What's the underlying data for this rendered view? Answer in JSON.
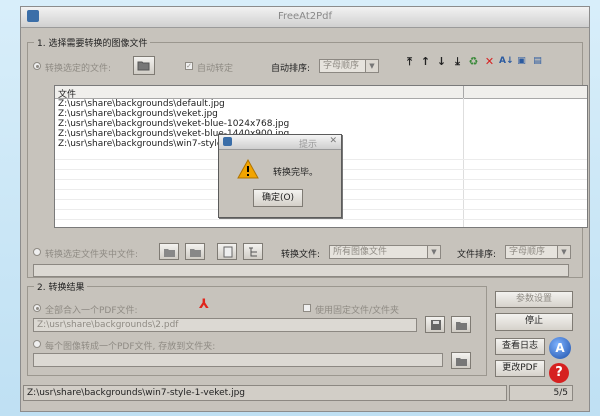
{
  "window": {
    "title": "FreeAt2Pdf"
  },
  "section1": {
    "title": "1. 选择需要转换的图像文件",
    "radio_files_label": "转换选定的文件:",
    "auto_rotate_label": "自动转定",
    "auto_sort_label": "自动排序:",
    "sort_combo": "字母顺序",
    "list_header": "文件",
    "files": [
      "Z:\\usr\\share\\backgrounds\\default.jpg",
      "Z:\\usr\\share\\backgrounds\\veket.jpg",
      "Z:\\usr\\share\\backgrounds\\veket-blue-1024x768.jpg",
      "Z:\\usr\\share\\backgrounds\\veket-blue-1440x900.jpg",
      "Z:\\usr\\share\\backgrounds\\win7-style-1-veket.jpg"
    ],
    "radio_folder_label": "转换选定文件夹中文件:",
    "convert_files_label": "转换文件:",
    "file_type_combo": "所有图像文件",
    "file_sort_label": "文件排序:",
    "file_sort_combo": "字母顺序"
  },
  "section2": {
    "title": "2. 转换结果",
    "radio_merge_label": "全部合入一个PDF文件:",
    "use_fixed_label": "使用固定文件/文件夹",
    "output_path": "Z:\\usr\\share\\backgrounds\\2.pdf",
    "radio_each_label": "每个图像转成一个PDF文件, 存放到文件夹:"
  },
  "buttons": {
    "params": "参数设置",
    "stop": "停止",
    "log": "查看日志",
    "update": "更改PDF"
  },
  "status": {
    "current_file": "Z:\\usr\\share\\backgrounds\\win7-style-1-veket.jpg",
    "progress": "5/5"
  },
  "dialog": {
    "title": "提示",
    "message": "转换完毕。",
    "ok_label": "确定(O)"
  },
  "colors": {
    "pdf_icon": "#e0241b",
    "warning": "#f2a400",
    "help": "#d62020"
  }
}
